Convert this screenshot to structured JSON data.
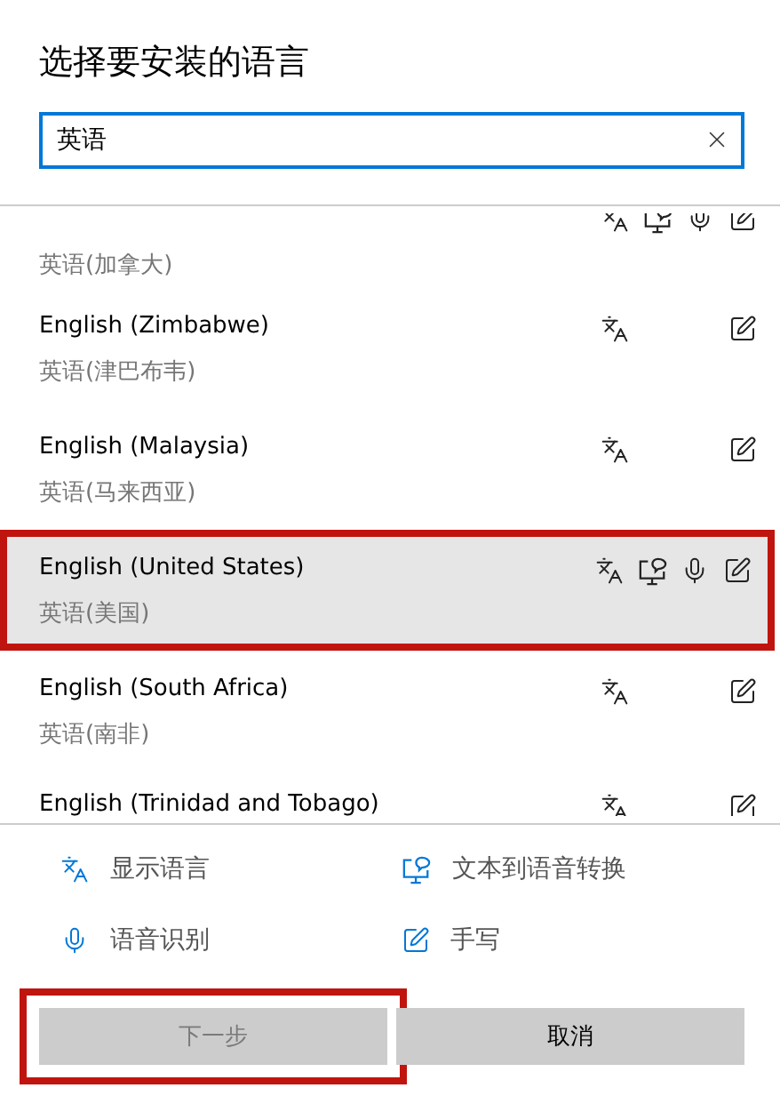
{
  "title": "选择要安装的语言",
  "search": {
    "value": "英语"
  },
  "languages": [
    {
      "native": "英语(加拿大)",
      "features": {
        "display": true,
        "tts": true,
        "speech": true,
        "handwriting": true
      },
      "selected": false,
      "annotated": false,
      "kind": "clipped_top"
    },
    {
      "name": "English (Zimbabwe)",
      "native": "英语(津巴布韦)",
      "features": {
        "display": true,
        "tts": false,
        "speech": false,
        "handwriting": true
      },
      "selected": false,
      "annotated": false,
      "kind": "full"
    },
    {
      "name": "English (Malaysia)",
      "native": "英语(马来西亚)",
      "features": {
        "display": true,
        "tts": false,
        "speech": false,
        "handwriting": true
      },
      "selected": false,
      "annotated": false,
      "kind": "full"
    },
    {
      "name": "English (United States)",
      "native": "英语(美国)",
      "features": {
        "display": true,
        "tts": true,
        "speech": true,
        "handwriting": true
      },
      "selected": true,
      "annotated": true,
      "kind": "full"
    },
    {
      "name": "English (South Africa)",
      "native": "英语(南非)",
      "features": {
        "display": true,
        "tts": false,
        "speech": false,
        "handwriting": true
      },
      "selected": false,
      "annotated": false,
      "kind": "full"
    },
    {
      "name": "English (Trinidad and Tobago)",
      "features": {
        "display": true,
        "tts": false,
        "speech": false,
        "handwriting": true
      },
      "selected": false,
      "annotated": false,
      "kind": "clipped_bottom"
    }
  ],
  "legend": [
    {
      "kind": "display",
      "label": "显示语言"
    },
    {
      "kind": "tts",
      "label": "文本到语音转换"
    },
    {
      "kind": "speech",
      "label": "语音识别"
    },
    {
      "kind": "handwriting",
      "label": "手写"
    }
  ],
  "buttons": [
    {
      "label": "下一步",
      "disabled": true,
      "annotated": true
    },
    {
      "label": "取消",
      "disabled": false,
      "annotated": false
    }
  ]
}
